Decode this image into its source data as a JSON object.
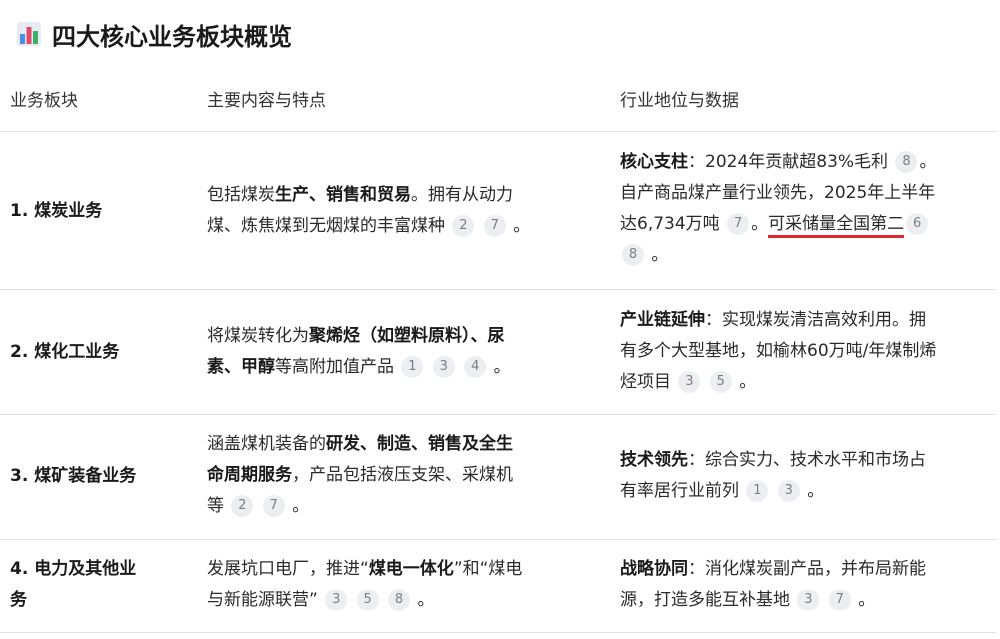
{
  "heading": {
    "icon": "bar-chart-icon",
    "title": "四大核心业务板块概览"
  },
  "columns": [
    "业务板块",
    "主要内容与特点",
    "行业地位与数据"
  ],
  "rows": [
    {
      "name": "1. 煤炭业务",
      "content": {
        "t1": "包括煤炭",
        "b1": "生产、销售和贸易",
        "t2": "。拥有从动力",
        "t3": "煤、炼焦煤到无烟煤的丰富煤种",
        "cites": [
          "2",
          "7"
        ],
        "end": "。"
      },
      "status": {
        "lead": "核心支柱",
        "l1": "：2024年贡献超83%毛利",
        "c1": "8",
        "l1b": "。",
        "l2": "自产商品煤产量行业领先，2025年上半年",
        "l3": "达6,734万吨",
        "c2": "7",
        "l3b": "。",
        "underlined": "可采储量全国第二",
        "c3": "6",
        "c4": "8",
        "l4b": "。"
      }
    },
    {
      "name": "2. 煤化工业务",
      "content": {
        "t1": "将煤炭转化为",
        "b1": "聚烯烃（如塑料原料）、尿",
        "b2": "素、甲醇",
        "t2": "等高附加值产品",
        "cites": [
          "1",
          "3",
          "4"
        ],
        "end": "。"
      },
      "status": {
        "lead": "产业链延伸",
        "l1": "：实现煤炭清洁高效利用。拥",
        "l2": "有多个大型基地，如榆林60万吨/年煤制烯",
        "l3": "烃项目",
        "cites": [
          "3",
          "5"
        ],
        "end": "。"
      }
    },
    {
      "name": "3. 煤矿装备业务",
      "content": {
        "t1": "涵盖煤机装备的",
        "b1": "研发、制造、销售及全生",
        "b2": "命周期服务",
        "t2": "，产品包括液压支架、采煤机",
        "t3": "等",
        "cites": [
          "2",
          "7"
        ],
        "end": "。"
      },
      "status": {
        "lead": "技术领先",
        "l1": "：综合实力、技术水平和市场占",
        "l2": "有率居行业前列",
        "cites": [
          "1",
          "3"
        ],
        "end": "。"
      }
    },
    {
      "name1": "4. 电力及其他业",
      "name2": "务",
      "content": {
        "t1": "发展坑口电厂，推进“",
        "b1": "煤电一体化",
        "t2": "”和“煤电",
        "t3": "与新能源联营”",
        "cites": [
          "3",
          "5",
          "8"
        ],
        "end": "。"
      },
      "status": {
        "lead": "战略协同",
        "l1": "：消化煤炭副产品，并布局新能",
        "l2": "源，打造多能互补基地",
        "cites": [
          "3",
          "7"
        ],
        "end": "。"
      }
    }
  ]
}
